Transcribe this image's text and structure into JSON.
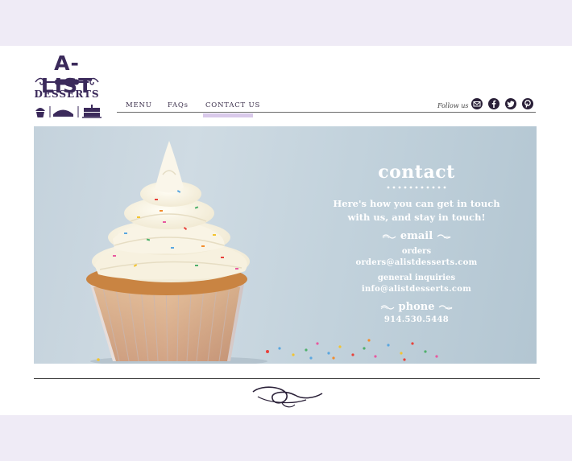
{
  "logo": {
    "title": "A-LIST",
    "subtitle": "DESSERTS",
    "icons": [
      "cupcake-icon",
      "pie-icon",
      "layer-cake-icon"
    ]
  },
  "nav": {
    "items": [
      {
        "label": "MENU"
      },
      {
        "label": "FAQs"
      },
      {
        "label": "CONTACT US",
        "active": true
      }
    ],
    "follow_label": "Follow us",
    "social": [
      "email-icon",
      "facebook-icon",
      "twitter-icon",
      "pinterest-icon"
    ]
  },
  "contact": {
    "title": "contact",
    "intro_line1": "Here's how you can get in touch",
    "intro_line2": "with us, and stay in touch!",
    "email_heading": "email",
    "orders_label": "orders",
    "orders_email": "orders@alistdesserts.com",
    "general_label": "general inquiries",
    "general_email": "info@alistdesserts.com",
    "phone_heading": "phone",
    "phone_number": "914.530.5448"
  },
  "colors": {
    "background": "#efebf6",
    "brand": "#3b2a5b",
    "active_tab": "#d9c9ea",
    "hero": "#c4d2dc"
  }
}
